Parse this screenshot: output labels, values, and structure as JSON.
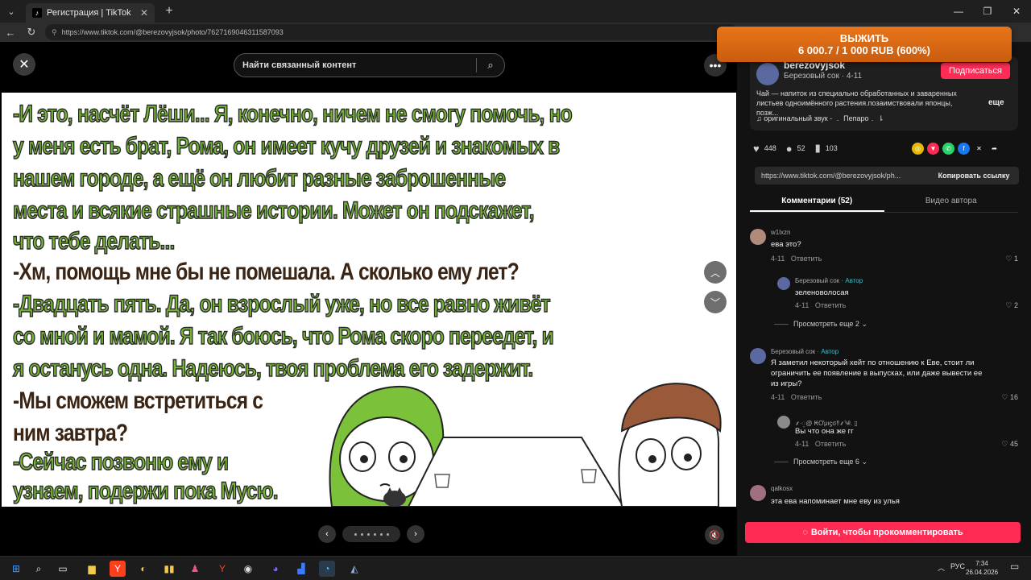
{
  "browser": {
    "tab_title": "Регистрация | TikTok",
    "url": "https://www.tiktok.com/@berezovyjsok/photo/7627169046311587093"
  },
  "promo": {
    "line1": "ВЫЖИТЬ",
    "line2": "6 000.7 / 1 000 RUB (600%)"
  },
  "media": {
    "search_placeholder": "Найти связанный контент",
    "comic_lines": [
      "-И это, насчёт Лёши... Я, конечно, ничем не смогу помочь, но",
      "у меня есть брат, Рома, он имеет кучу друзей и знакомых в",
      "нашем городе,  а ещё он любит разные заброшенные",
      "места и всякие страшные истории. Может он подскажет,",
      "что тебе делать...",
      "-Хм, помощь мне бы не помешала. А сколько ему лет?",
      "-Двадцать пять. Да, он взрослый уже, но все равно живёт",
      "со мной и мамой. Я так боюсь, что Рома скоро переедет, и",
      "я останусь одна. Надеюсь, твоя проблема его задержит.",
      "-Мы сможем встретиться с",
      "ним завтра?",
      "-Сейчас позвоню ему и",
      "узнаем, подержи пока Мусю."
    ]
  },
  "panel": {
    "author_name": "berezovyjsok",
    "author_sub": "Березовый сок · 4-11",
    "subscribe_label": "Подписаться",
    "description": "Чай — напиток из специально обработанных и заваренных листьев одноимённого растения.позаимствовали японцы, позж...",
    "more_label": "еще",
    "sound": "♫  оригинальный звук - ﹒ Пепаро﹒ ⇂",
    "likes": "448",
    "comments_count": "52",
    "saves": "103",
    "link_url": "https://www.tiktok.com/@berezovyjsok/ph...",
    "copy_label": "Копировать ссылку",
    "tab_comments": "Комментарии (52)",
    "tab_author_videos": "Видео автора",
    "login_button": "Войти, чтобы прокомментировать"
  },
  "comments": [
    {
      "name": "w1lxzn",
      "tag": "",
      "text": "ева это?",
      "date": "4-11",
      "reply": "Ответить",
      "likes": "1"
    },
    {
      "name": "Березовый сок",
      "tag": " · Автор",
      "text": "зеленоволосая",
      "date": "4-11",
      "reply": "Ответить",
      "likes": "2"
    },
    {
      "name": "Березовый сок",
      "tag": " · Автор",
      "text": "Я заметил некоторый хейт по отношению к Еве, стоит ли ограничить ее появление в выпусках, или даже вывести ее из игры?",
      "date": "4-11",
      "reply": "Ответить",
      "likes": "16"
    },
    {
      "name": "⸙·◌̥@ ₭Ơμιϛσ‼︎⸙༄. ▯",
      "tag": "",
      "text": "Вы что она же гг",
      "date": "4-11",
      "reply": "Ответить",
      "likes": "45"
    },
    {
      "name": "qalkosx",
      "tag": "",
      "text": "эта ева напоминает мне еву из улья",
      "date": "",
      "reply": "",
      "likes": ""
    }
  ],
  "more_replies": [
    "Просмотреть еще 2 ⌄",
    "Просмотреть еще 6 ⌄"
  ],
  "taskbar": {
    "lang": "РУС",
    "time": "7:34",
    "date": "26.04.2026"
  },
  "colors": {
    "accent": "#fe2c55",
    "promo": "#e8751a",
    "comic_green": "#74b535",
    "comic_dark": "#3a2414",
    "author_tag": "#2ec4d6"
  }
}
